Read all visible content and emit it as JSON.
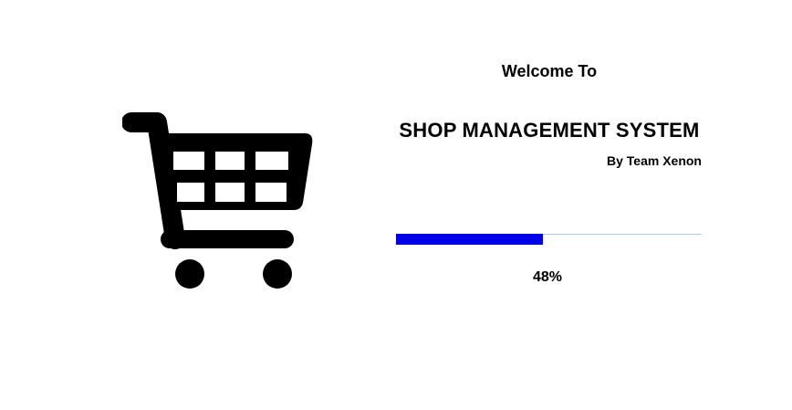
{
  "splash": {
    "icon": "shopping-cart-icon",
    "welcome_text": "Welcome To",
    "title": "SHOP MANAGEMENT SYSTEM",
    "byline": "By Team Xenon",
    "progress": {
      "value_percent": 48,
      "label": "48%",
      "fill_color": "#0000e6",
      "track_color": "#b8c8d8"
    }
  }
}
